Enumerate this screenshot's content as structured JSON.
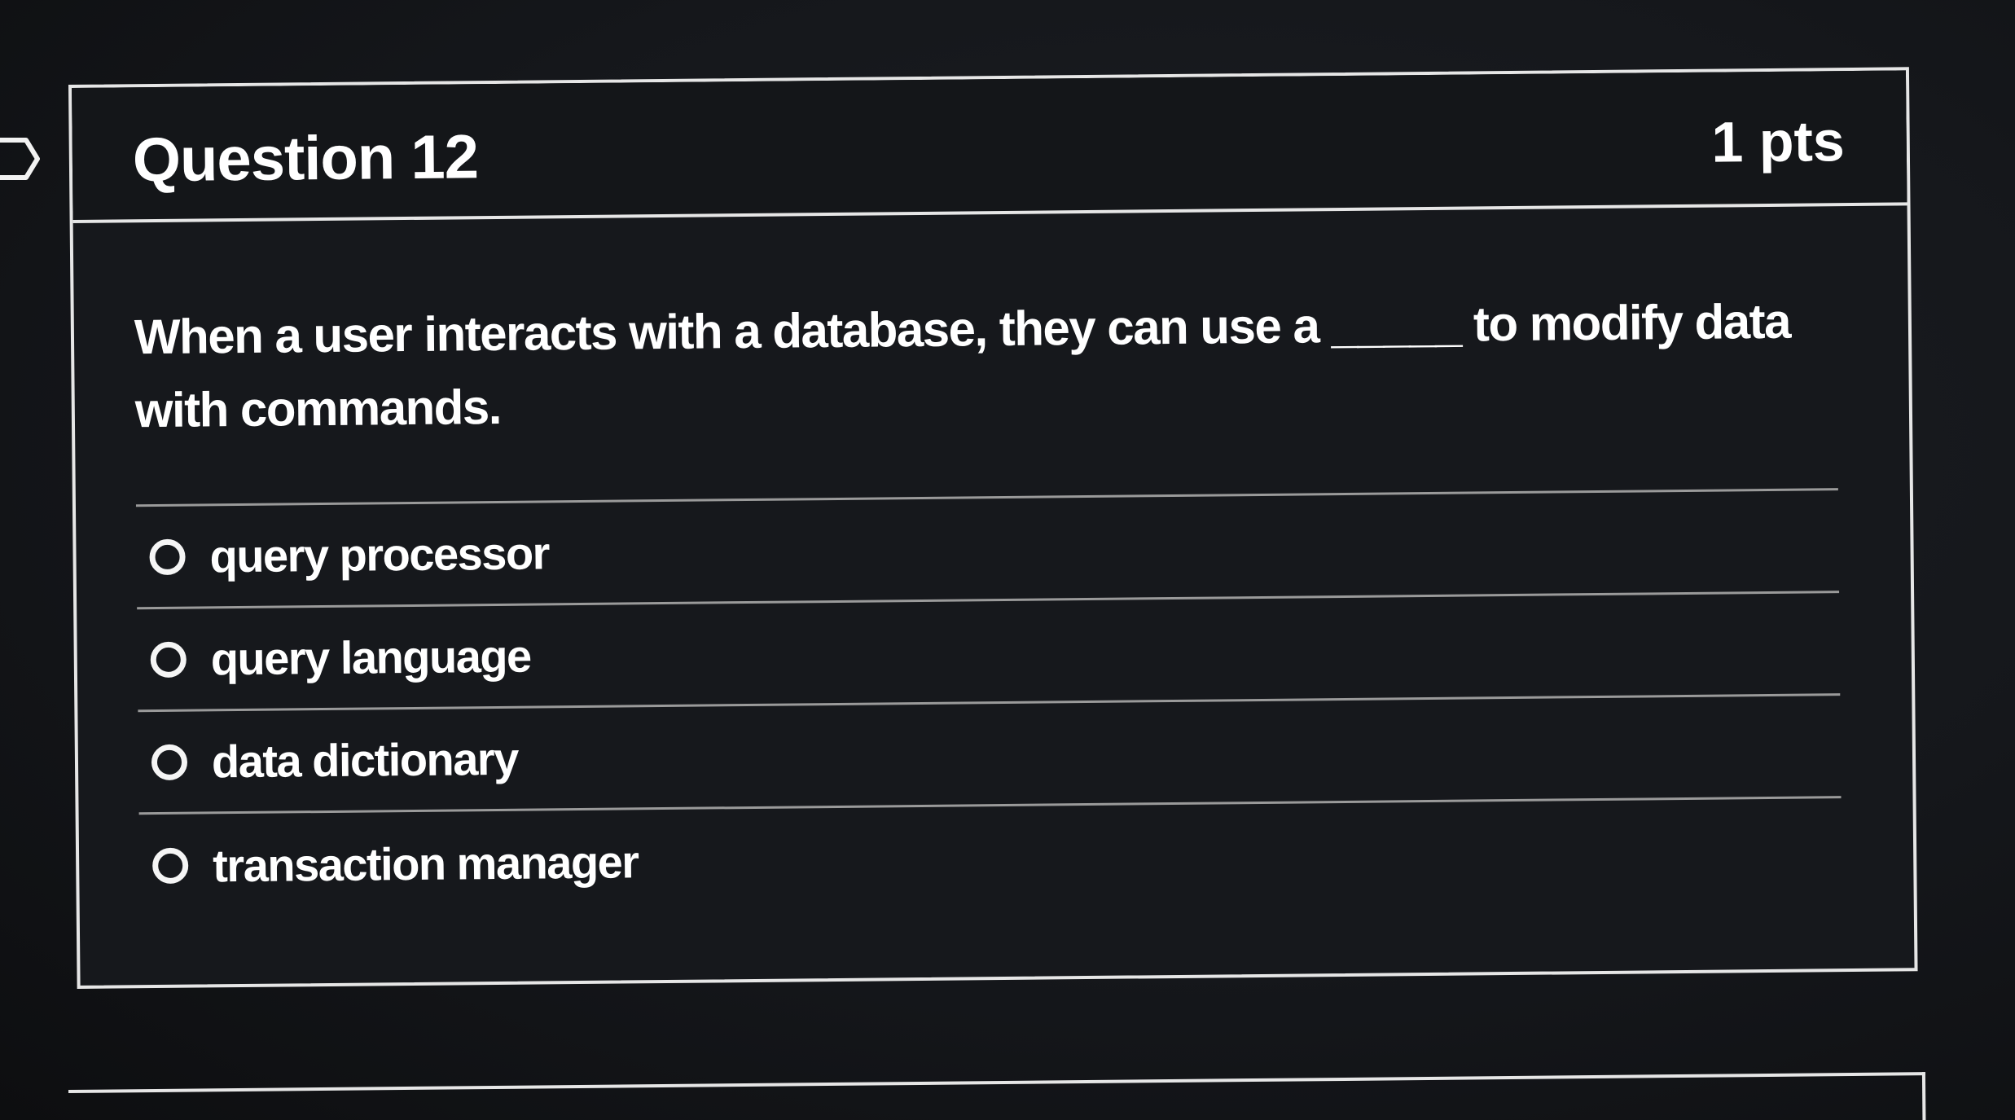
{
  "question": {
    "title": "Question 12",
    "points": "1 pts",
    "text": "When a user interacts with a database, they can use a _____ to modify data with commands."
  },
  "answers": [
    {
      "label": "query processor",
      "selected": false
    },
    {
      "label": "query language",
      "selected": false
    },
    {
      "label": "data dictionary",
      "selected": false
    },
    {
      "label": "transaction manager",
      "selected": false
    }
  ],
  "icons": {
    "flag": "flag-outline-icon",
    "radio": "radio-unchecked-icon"
  },
  "colors": {
    "background": "#15171b",
    "border": "#e6e6e6",
    "text": "#ffffff",
    "divider": "#9a9a9a"
  }
}
